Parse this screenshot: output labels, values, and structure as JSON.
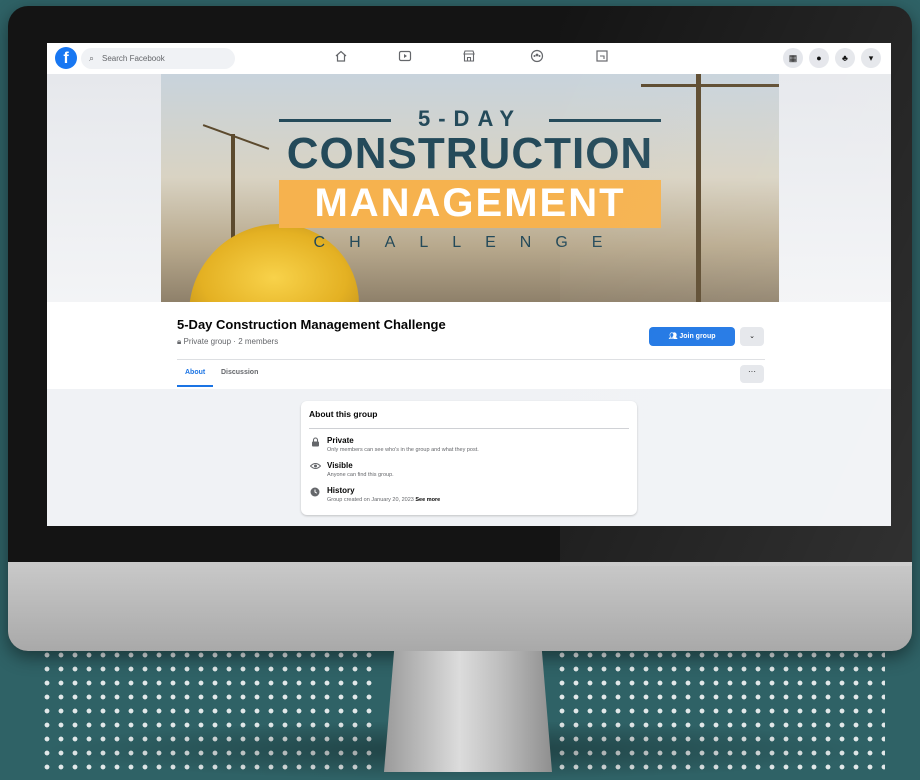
{
  "topbar": {
    "logo": "f",
    "search_placeholder": "Search Facebook",
    "nav_icons": [
      "home-icon",
      "watch-icon",
      "marketplace-icon",
      "groups-icon",
      "gaming-icon"
    ],
    "right_icons": [
      "menu-grid-icon",
      "messenger-icon",
      "notifications-icon",
      "account-chevron-icon"
    ]
  },
  "cover": {
    "line1": "5-DAY",
    "line2": "CONSTRUCTION",
    "line3": "MANAGEMENT",
    "line4": "CHALLENGE"
  },
  "group": {
    "title": "5-Day Construction Management Challenge",
    "meta": "Private group · 2 members",
    "join_label": "Join group",
    "dropdown_label": "⌄",
    "more_label": "···"
  },
  "tabs": [
    {
      "label": "About",
      "active": true
    },
    {
      "label": "Discussion",
      "active": false
    }
  ],
  "about": {
    "heading": "About this group",
    "items": [
      {
        "icon": "lock-icon",
        "title": "Private",
        "desc": "Only members can see who's in the group and what they post."
      },
      {
        "icon": "eye-icon",
        "title": "Visible",
        "desc": "Anyone can find this group."
      },
      {
        "icon": "clock-icon",
        "title": "History",
        "desc": "Group created on January 20, 2023",
        "link": "See more"
      }
    ]
  },
  "colors": {
    "brand": "#1877f2",
    "join_button": "#1b74e4",
    "cover_accent": "#f6b24e",
    "cover_text": "#244a5a",
    "background": "#2f6266"
  }
}
